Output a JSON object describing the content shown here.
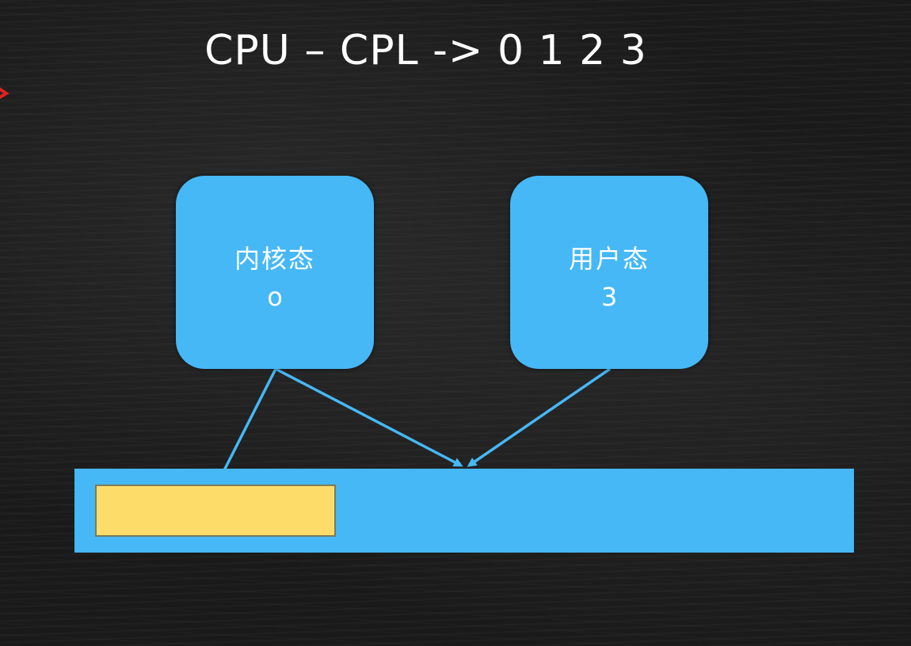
{
  "title": "CPU – CPL -> 0 1 2 3",
  "kernel_state": {
    "label": "内核态",
    "level": "o"
  },
  "user_state": {
    "label": "用户态",
    "level": "3"
  },
  "colors": {
    "background": "#1a1a1a",
    "box_fill": "#46b8f5",
    "segment_fill": "#fddc6a",
    "arrow": "#46b8f5",
    "red_mark": "#e02020"
  }
}
